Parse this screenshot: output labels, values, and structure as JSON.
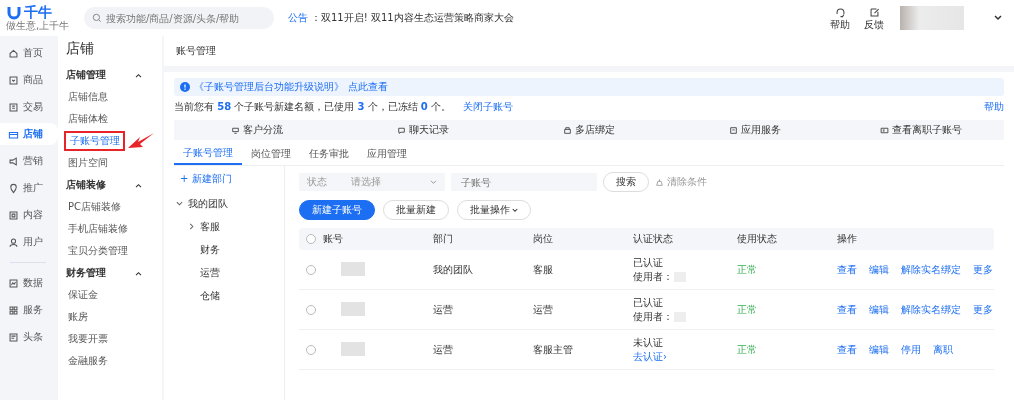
{
  "logo": {
    "name": "千牛",
    "tagline": "做生意,上千牛"
  },
  "search": {
    "placeholder": "搜索功能/商品/资源/头条/帮助"
  },
  "notice": {
    "label": "公告",
    "separator": "：",
    "text": "双11开启! 双11内容生态运营策略商家大会"
  },
  "header_actions": [
    {
      "label": "帮助"
    },
    {
      "label": "反馈"
    }
  ],
  "nav": [
    {
      "label": "首页",
      "selected": false
    },
    {
      "label": "商品",
      "selected": false
    },
    {
      "label": "交易",
      "selected": false
    },
    {
      "label": "店铺",
      "selected": true
    },
    {
      "label": "营销",
      "selected": false
    },
    {
      "label": "推广",
      "selected": false
    },
    {
      "label": "内容",
      "selected": false
    },
    {
      "label": "用户",
      "selected": false
    }
  ],
  "nav_secondary": [
    {
      "label": "数据",
      "selected": false
    },
    {
      "label": "服务",
      "selected": false
    },
    {
      "label": "头条",
      "selected": false
    }
  ],
  "sidebar": {
    "title": "店铺",
    "groups": [
      {
        "label": "店铺管理",
        "expanded": true,
        "items": [
          {
            "label": "店铺信息",
            "selected": false
          },
          {
            "label": "店铺体检",
            "selected": false
          },
          {
            "label": "子账号管理",
            "selected": true
          },
          {
            "label": "图片空间",
            "selected": false
          }
        ]
      },
      {
        "label": "店铺装修",
        "expanded": true,
        "items": [
          {
            "label": "PC店铺装修",
            "selected": false
          },
          {
            "label": "手机店铺装修",
            "selected": false
          },
          {
            "label": "宝贝分类管理",
            "selected": false
          }
        ]
      },
      {
        "label": "财务管理",
        "expanded": true,
        "items": [
          {
            "label": "保证金",
            "selected": false
          },
          {
            "label": "账房",
            "selected": false
          },
          {
            "label": "我要开票",
            "selected": false
          },
          {
            "label": "金融服务",
            "selected": false
          }
        ]
      }
    ]
  },
  "breadcrumb": "账号管理",
  "banner": {
    "title": "《子账号管理后台功能升级说明》",
    "link": "点此查看"
  },
  "quota": {
    "text": "当前您有 **58** 个子账号新建名额，已使用 **3** 个，已冻结 **0** 个。",
    "link": "关闭子账号",
    "help": "帮助"
  },
  "features": [
    {
      "label": "客户分流"
    },
    {
      "label": "聊天记录"
    },
    {
      "label": "多店绑定"
    },
    {
      "label": "应用服务"
    },
    {
      "label": "查看离职子账号"
    }
  ],
  "tabs": [
    {
      "label": "子账号管理",
      "selected": true
    },
    {
      "label": "岗位管理",
      "selected": false
    },
    {
      "label": "任务审批",
      "selected": false
    },
    {
      "label": "应用管理",
      "selected": false
    }
  ],
  "tree": {
    "add": "+ 新建部门",
    "root": {
      "label": "我的团队",
      "expanded": true,
      "children": [
        {
          "label": "客服",
          "expanded": false
        },
        {
          "label": "财务"
        },
        {
          "label": "运营"
        },
        {
          "label": "仓储"
        }
      ]
    }
  },
  "filter": {
    "status_label": "状态",
    "status_placeholder": "请选择",
    "account_placeholder": "子账号",
    "search": "搜索",
    "clear": "清除条件"
  },
  "actions": [
    {
      "label": "新建子账号",
      "kind": "primary"
    },
    {
      "label": "批量新建",
      "kind": "default"
    },
    {
      "label": "批量操作",
      "kind": "dropdown"
    }
  ],
  "table": {
    "columns": [
      "账号",
      "部门",
      "岗位",
      "认证状态",
      "使用状态",
      "操作"
    ],
    "header_checked": false,
    "rows": [
      {
        "checked": false,
        "department": "我的团队",
        "position": "客服",
        "cert": {
          "status": "已认证",
          "verified": true,
          "detail": "使用者："
        },
        "state": "正常",
        "ops": [
          "查看",
          "编辑",
          "解除实名绑定",
          "更多"
        ]
      },
      {
        "checked": false,
        "department": "运营",
        "position": "运营",
        "cert": {
          "status": "已认证",
          "verified": true,
          "detail": "使用者："
        },
        "state": "正常",
        "ops": [
          "查看",
          "编辑",
          "解除实名绑定",
          "更多"
        ]
      },
      {
        "checked": false,
        "department": "运营",
        "position": "客服主管",
        "cert": {
          "status": "未认证",
          "verified": false,
          "detail": "去认证›"
        },
        "state": "正常",
        "ops": [
          "查看",
          "编辑",
          "停用",
          "离职"
        ]
      }
    ]
  }
}
